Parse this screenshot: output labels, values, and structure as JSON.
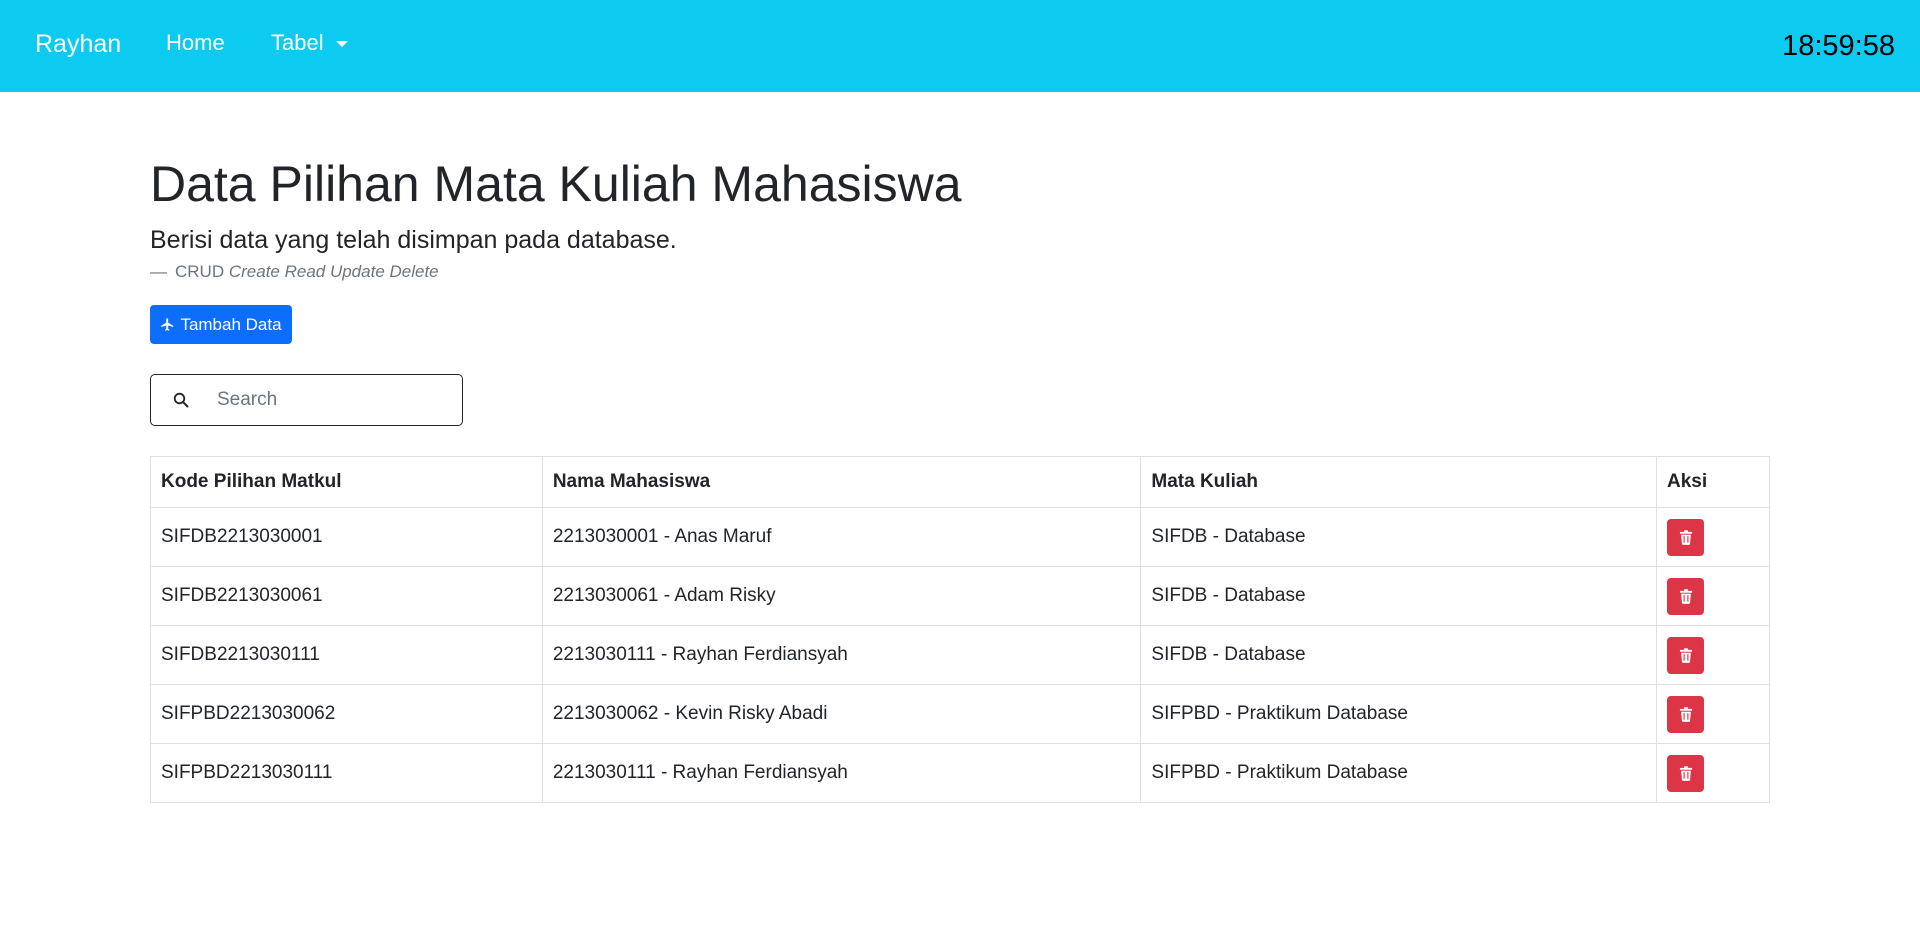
{
  "navbar": {
    "brand": "Rayhan",
    "home_label": "Home",
    "tabel_label": "Tabel",
    "clock": "18:59:58"
  },
  "page": {
    "title": "Data Pilihan Mata Kuliah Mahasiswa",
    "subtitle": "Berisi data yang telah disimpan pada database.",
    "footer_dash": "—",
    "footer_prefix": "CRUD",
    "footer_cite": "Create Read Update Delete",
    "add_button_label": "Tambah Data"
  },
  "search": {
    "placeholder": "Search",
    "value": ""
  },
  "table": {
    "headers": [
      "Kode Pilihan Matkul",
      "Nama Mahasiswa",
      "Mata Kuliah",
      "Aksi"
    ],
    "rows": [
      [
        "SIFDB2213030001",
        "2213030001 - Anas Maruf",
        "SIFDB - Database"
      ],
      [
        "SIFDB2213030061",
        "2213030061 - Adam Risky",
        "SIFDB - Database"
      ],
      [
        "SIFDB2213030111",
        "2213030111 - Rayhan Ferdiansyah",
        "SIFDB - Database"
      ],
      [
        "SIFPBD2213030062",
        "2213030062 - Kevin Risky Abadi",
        "SIFPBD - Praktikum Database"
      ],
      [
        "SIFPBD2213030111",
        "2213030111 - Rayhan Ferdiansyah",
        "SIFPBD - Praktikum Database"
      ]
    ]
  },
  "icons": {
    "add": "plane-icon",
    "search": "search-icon",
    "delete": "trash-icon",
    "dropdown": "caret-down-icon"
  },
  "colors": {
    "navbar": "#0dcaf0",
    "primary": "#0d6efd",
    "danger": "#dc3545"
  }
}
